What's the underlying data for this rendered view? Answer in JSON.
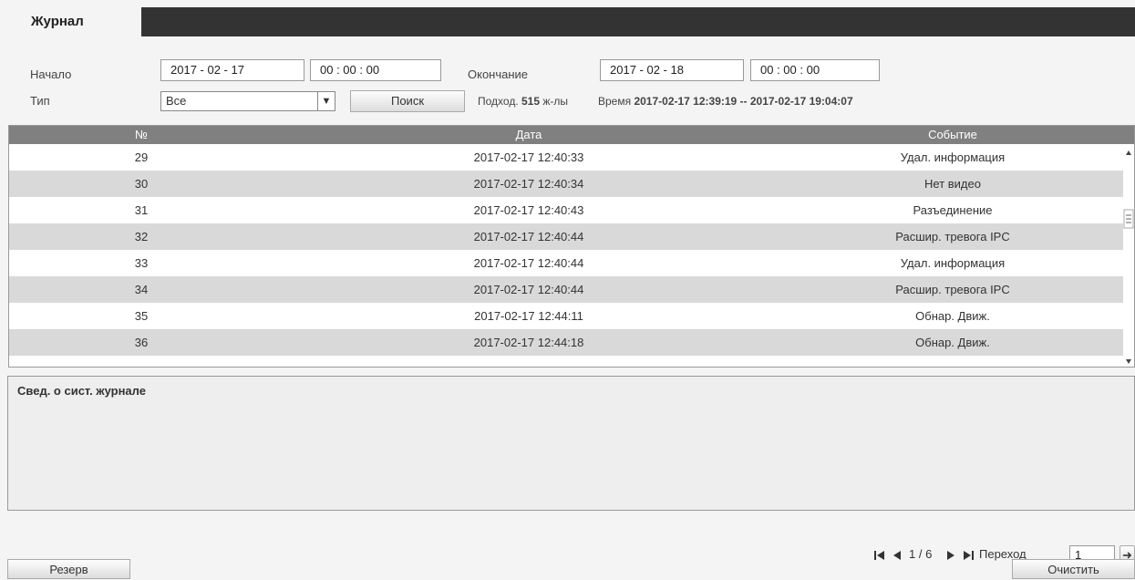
{
  "tab": {
    "label": "Журнал"
  },
  "filters": {
    "start_label": "Начало",
    "start_date": "2017 - 02 - 17",
    "start_time": "00 : 00 : 00",
    "end_label": "Окончание",
    "end_date": "2017 - 02 - 18",
    "end_time": "00 : 00 : 00",
    "type_label": "Тип",
    "type_value": "Все",
    "search_label": "Поиск",
    "found_prefix": "Подход.",
    "found_count": "515",
    "found_suffix": "ж-лы",
    "time_prefix": "Время",
    "time_range": "2017-02-17 12:39:19 -- 2017-02-17 19:04:07"
  },
  "table": {
    "headers": {
      "no": "№",
      "date": "Дата",
      "event": "Событие"
    },
    "rows": [
      {
        "no": "29",
        "date": "2017-02-17 12:40:33",
        "event": "Удал. информация"
      },
      {
        "no": "30",
        "date": "2017-02-17 12:40:34",
        "event": "Нет видео"
      },
      {
        "no": "31",
        "date": "2017-02-17 12:40:43",
        "event": "Разъединение"
      },
      {
        "no": "32",
        "date": "2017-02-17 12:40:44",
        "event": "Расшир. тревога IPC"
      },
      {
        "no": "33",
        "date": "2017-02-17 12:40:44",
        "event": "Удал. информация"
      },
      {
        "no": "34",
        "date": "2017-02-17 12:40:44",
        "event": "Расшир. тревога IPC"
      },
      {
        "no": "35",
        "date": "2017-02-17 12:44:11",
        "event": "Обнар. Движ."
      },
      {
        "no": "36",
        "date": "2017-02-17 12:44:18",
        "event": "Обнар. Движ."
      }
    ]
  },
  "info": {
    "title": "Свед. о сист. журнале"
  },
  "pager": {
    "page": "1 / 6",
    "goto_label": "Переход",
    "goto_value": "1"
  },
  "footer": {
    "backup_label": "Резерв",
    "clear_label": "Очистить"
  }
}
